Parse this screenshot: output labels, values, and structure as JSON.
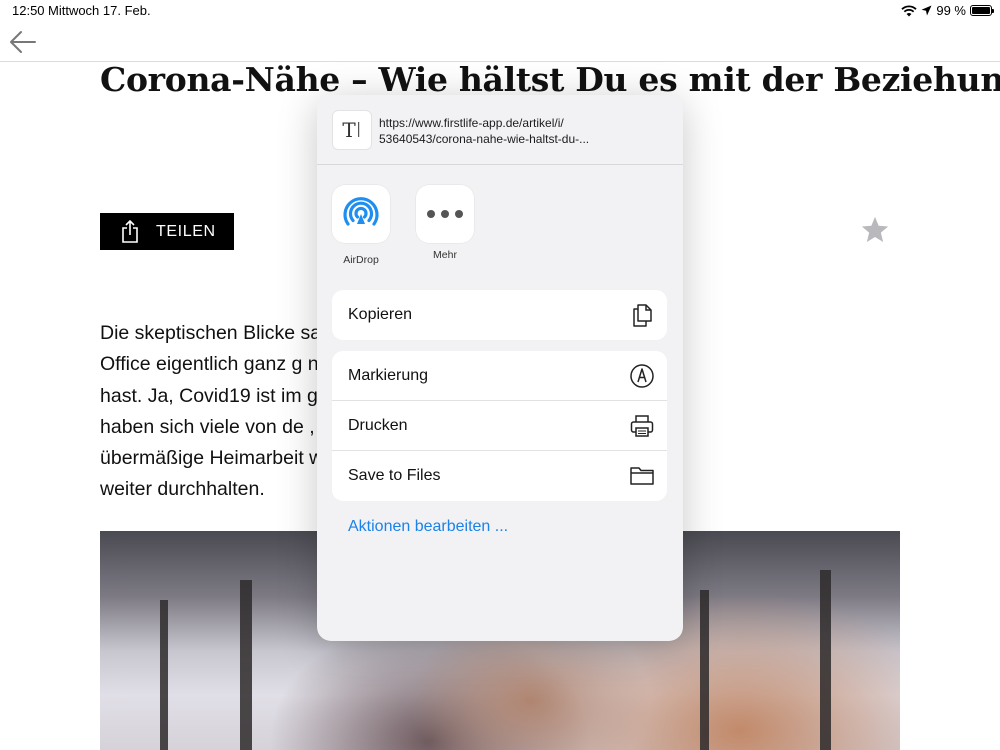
{
  "status_bar": {
    "time": "12:50",
    "date": "Mittwoch 17. Feb.",
    "battery": "99 %"
  },
  "article": {
    "title": "Corona-Nähe – Wie hältst Du es mit der Beziehung?",
    "share_label": "TEILEN",
    "body_lines": [
      "Die skeptischen Blicke                                                    sagst, dass du Home-",
      "Office eigentlich ganz g                                                   nem Partner gestritten",
      "hast. Ja, Covid19 ist im                                                  ge nicht vorbei. Doch",
      "haben sich viele von de                                                   , die durch die",
      "übermäßige Heimarbeit                                                    wie wir jetzt am besten",
      "weiter durchhalten."
    ]
  },
  "share_sheet": {
    "url_line1": "https://www.firstlife-app.de/artikel/i/",
    "url_line2": "53640543/corona-nahe-wie-haltst-du-...",
    "apps": [
      {
        "label": "AirDrop",
        "icon": "airdrop-icon"
      },
      {
        "label": "Mehr",
        "icon": "more-icon"
      }
    ],
    "copy_label": "Kopieren",
    "actions": [
      {
        "label": "Markierung",
        "icon": "markup-icon"
      },
      {
        "label": "Drucken",
        "icon": "printer-icon"
      },
      {
        "label": "Save to Files",
        "icon": "folder-icon"
      }
    ],
    "edit_actions": "Aktionen bearbeiten ...",
    "accent_color": "#1a82e8"
  }
}
